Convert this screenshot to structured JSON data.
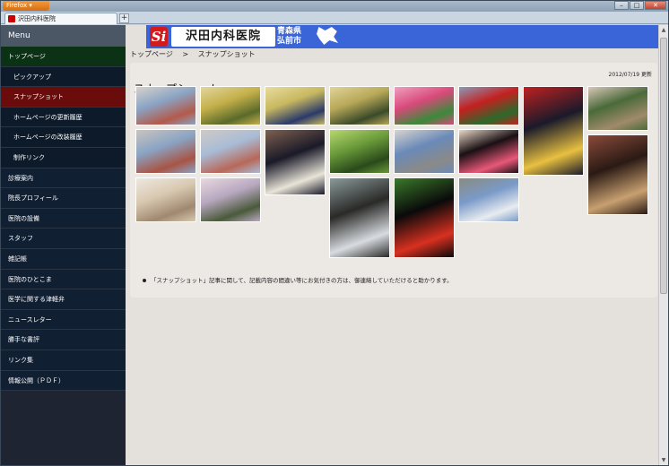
{
  "browser": {
    "app_button": "Firefox",
    "tab_title": "沢田内科医院",
    "new_tab": "+",
    "controls": {
      "minimize": "–",
      "maximize": "□",
      "close": "✕"
    }
  },
  "sidebar": {
    "header": "Menu",
    "items": [
      {
        "label": "トップページ",
        "kind": "top"
      },
      {
        "label": "ピックアップ",
        "kind": "sub"
      },
      {
        "label": "スナップショット",
        "kind": "active"
      },
      {
        "label": "ホームページの更新履歴",
        "kind": "sub"
      },
      {
        "label": "ホームページの改装履歴",
        "kind": "sub"
      },
      {
        "label": "制作リンク",
        "kind": "sub"
      },
      {
        "label": "診療案内",
        "kind": "normal"
      },
      {
        "label": "院長プロフィール",
        "kind": "normal"
      },
      {
        "label": "医院の設備",
        "kind": "normal"
      },
      {
        "label": "スタッフ",
        "kind": "normal"
      },
      {
        "label": "雑記帳",
        "kind": "normal"
      },
      {
        "label": "医院のひとこま",
        "kind": "normal"
      },
      {
        "label": "医学に関する津軽弁",
        "kind": "normal"
      },
      {
        "label": "ニュースレター",
        "kind": "normal"
      },
      {
        "label": "勝手な書評",
        "kind": "normal"
      },
      {
        "label": "リンク集",
        "kind": "normal"
      },
      {
        "label": "情報公開（ＰＤＦ）",
        "kind": "normal"
      }
    ]
  },
  "banner": {
    "logo_mark": "Si",
    "logo_text": "沢田内科医院",
    "place_line1": "青森県",
    "place_line2": "弘前市"
  },
  "breadcrumb": {
    "home": "トップページ",
    "separator": ">",
    "current": "スナップショット"
  },
  "content": {
    "updated": "2012/07/19 更新",
    "title": "スナップショット",
    "notice": "「スナップショット」記事に関して、記載内容の間違い等にお気付きの方は、御連絡していただけると助かります。"
  },
  "photos": [
    {
      "name": "photo-clinic-building",
      "colors": [
        "#8aa4c4",
        "#b35a4a",
        "#d8d2cc"
      ]
    },
    {
      "name": "photo-rice-field-art-1",
      "colors": [
        "#c4b04a",
        "#5a6a2a",
        "#e2d6a0"
      ]
    },
    {
      "name": "photo-rice-field-wave",
      "colors": [
        "#c8b860",
        "#2a3a6a",
        "#e8dca0"
      ]
    },
    {
      "name": "photo-rice-field-art-3",
      "colors": [
        "#b8a858",
        "#3a4a2a",
        "#e0d49a"
      ]
    },
    {
      "name": "photo-tulips-pink",
      "colors": [
        "#d84a7a",
        "#3a8a3a",
        "#f0a0c0"
      ]
    },
    {
      "name": "photo-tulips-red",
      "colors": [
        "#c42020",
        "#2a6a2a",
        "#8a9ab8"
      ]
    },
    {
      "name": "photo-nebuta-lantern",
      "colors": [
        "#1a1a2a",
        "#e8c040",
        "#c02020"
      ]
    },
    {
      "name": "photo-garden",
      "colors": [
        "#4a6a3a",
        "#a08a6a",
        "#d8c8b8"
      ]
    },
    {
      "name": "photo-clinic-front",
      "colors": [
        "#8aa4c4",
        "#a85444",
        "#cac4be"
      ]
    },
    {
      "name": "photo-clinic-side",
      "colors": [
        "#a8bcd6",
        "#b86858",
        "#d0cac4"
      ]
    },
    {
      "name": "photo-castle-night",
      "colors": [
        "#1a1a28",
        "#e8e4d8",
        "#806050"
      ]
    },
    {
      "name": "photo-rice-field-green",
      "colors": [
        "#6a9a3a",
        "#2a4a1a",
        "#b8d870"
      ]
    },
    {
      "name": "photo-city-mountain",
      "colors": [
        "#6a8ab8",
        "#8a8a88",
        "#d8d4d0"
      ]
    },
    {
      "name": "photo-lantern-lights",
      "colors": [
        "#1a1014",
        "#e85878",
        "#e8d8c8"
      ]
    },
    {
      "name": "photo-taiko-drum",
      "colors": [
        "#2a1a14",
        "#c8a070",
        "#8a4a3a"
      ]
    },
    {
      "name": "photo-cat",
      "colors": [
        "#d8c8b0",
        "#a08870",
        "#eee8e0"
      ]
    },
    {
      "name": "photo-cherry-pond",
      "colors": [
        "#b8a8c0",
        "#4a5a3a",
        "#e8d8e0"
      ]
    },
    {
      "name": "photo-icicles",
      "colors": [
        "#2a2a28",
        "#d8dce0",
        "#8a9a9a"
      ]
    },
    {
      "name": "photo-amaryllis",
      "colors": [
        "#0a0a0a",
        "#d83020",
        "#3a7a2a"
      ]
    },
    {
      "name": "photo-snow-lanterns",
      "colors": [
        "#7a9ac8",
        "#e8ecf0",
        "#8a8a80"
      ]
    }
  ]
}
